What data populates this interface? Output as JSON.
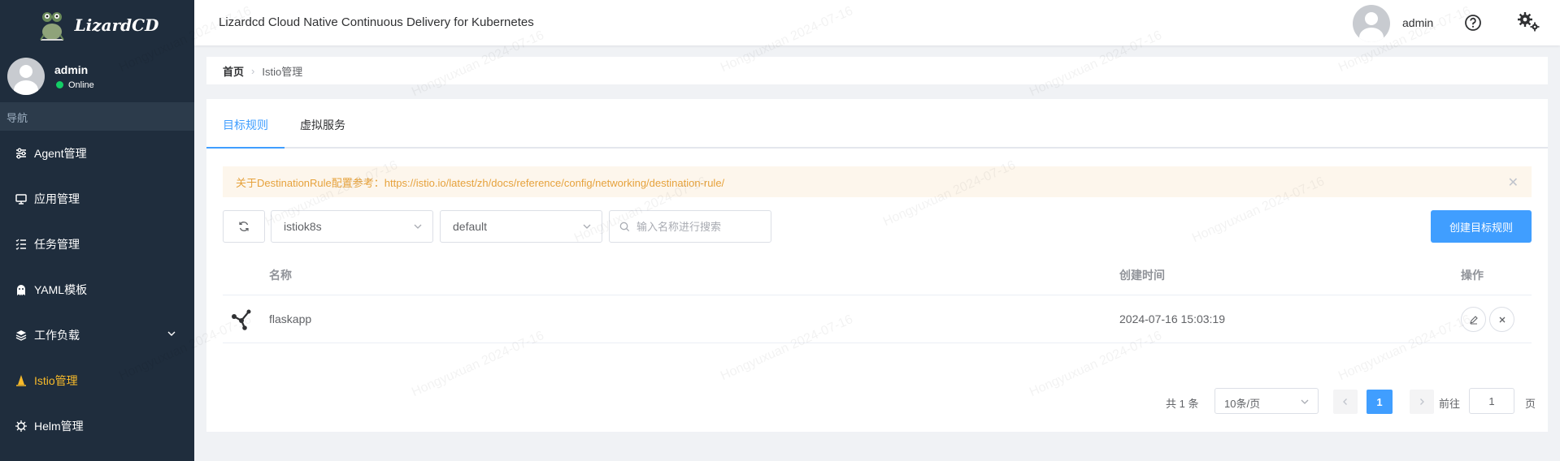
{
  "app": {
    "logo_text": "LizardCD",
    "title": "Lizardcd Cloud Native Continuous Delivery for Kubernetes"
  },
  "sidebar": {
    "user": {
      "name": "admin",
      "status": "Online"
    },
    "nav_header": "导航",
    "items": [
      {
        "label": "Agent管理",
        "icon": "sliders-icon"
      },
      {
        "label": "应用管理",
        "icon": "monitor-icon"
      },
      {
        "label": "任务管理",
        "icon": "task-list-icon"
      },
      {
        "label": "YAML模板",
        "icon": "ghost-icon"
      },
      {
        "label": "工作负载",
        "icon": "layers-icon"
      },
      {
        "label": "Istio管理",
        "icon": "sail-icon",
        "active": true
      },
      {
        "label": "Helm管理",
        "icon": "helm-icon"
      }
    ]
  },
  "topbar": {
    "username": "admin"
  },
  "breadcrumb": {
    "home": "首页",
    "current": "Istio管理"
  },
  "tabs": [
    {
      "label": "目标规则",
      "active": true
    },
    {
      "label": "虚拟服务",
      "active": false
    }
  ],
  "alert": {
    "text": "关于DestinationRule配置参考：https://istio.io/latest/zh/docs/reference/config/networking/destination-rule/"
  },
  "filters": {
    "cluster": "istiok8s",
    "namespace": "default",
    "search_placeholder": "输入名称进行搜索"
  },
  "create_button": "创建目标规则",
  "table": {
    "headers": {
      "name": "名称",
      "created": "创建时间",
      "ops": "操作"
    },
    "rows": [
      {
        "name": "flaskapp",
        "created": "2024-07-16 15:03:19"
      }
    ]
  },
  "pagination": {
    "total": "共 1 条",
    "page_size": "10条/页",
    "current_page": "1",
    "goto_label": "前往",
    "goto_value": "1",
    "page_suffix": "页"
  },
  "colors": {
    "sidebar_bg": "#1f2d3d",
    "accent": "#409eff",
    "active_nav": "#f7ba2a",
    "alert_bg": "#fdf6ec",
    "alert_text": "#e6a23c"
  },
  "watermark_text": "Hongyuxuan  2024-07-16"
}
